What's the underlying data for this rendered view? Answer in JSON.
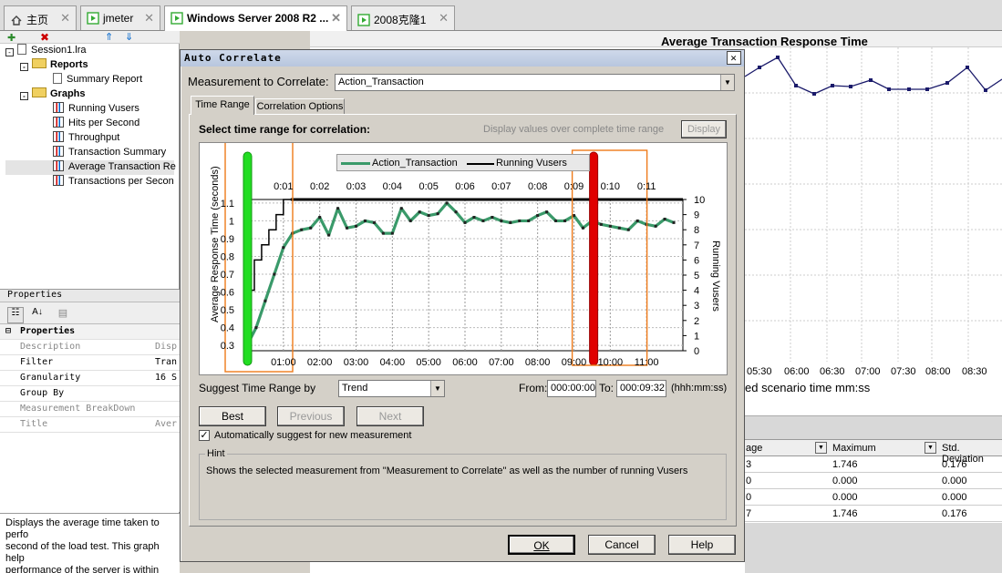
{
  "tabs": [
    {
      "label": "主页",
      "active": false
    },
    {
      "label": "jmeter",
      "active": false
    },
    {
      "label": "Windows Server 2008 R2 ...",
      "active": true
    },
    {
      "label": "2008克隆1",
      "active": false
    }
  ],
  "tree": {
    "session": "Session1.lra",
    "reports": "Reports",
    "summary_report": "Summary Report",
    "graphs": "Graphs",
    "items": [
      "Running Vusers",
      "Hits per Second",
      "Throughput",
      "Transaction Summary",
      "Average Transaction Re",
      "Transactions per Secon"
    ]
  },
  "properties": {
    "panel_title": "Properties",
    "section": "Properties",
    "rows": [
      {
        "key": "Description",
        "value": "Disp",
        "gray": true
      },
      {
        "key": "Filter",
        "value": "Tran",
        "gray": false
      },
      {
        "key": "Granularity",
        "value": "16 S",
        "gray": false
      },
      {
        "key": "Group By",
        "value": "",
        "gray": false
      },
      {
        "key": "Measurement BreakDown",
        "value": "",
        "gray": true
      },
      {
        "key": "Title",
        "value": "Aver",
        "gray": true
      }
    ]
  },
  "description_lines": [
    "Displays the average time taken to perfo",
    "second of the load test. This graph help",
    "performance of the server is within acce"
  ],
  "background_graph": {
    "title": "Average Transaction Response Time",
    "x_ticks": [
      "05:30",
      "06:00",
      "06:30",
      "07:00",
      "07:30",
      "08:00",
      "08:30"
    ],
    "x_label": "ed scenario time mm:ss"
  },
  "grid": {
    "headers": [
      "age",
      "Maximum",
      "Std. Deviation"
    ],
    "rows": [
      [
        "3",
        "1.746",
        "0.176"
      ],
      [
        "0",
        "0.000",
        "0.000"
      ],
      [
        "0",
        "0.000",
        "0.000"
      ],
      [
        "7",
        "1.746",
        "0.176"
      ]
    ]
  },
  "dialog": {
    "title": "Auto Correlate",
    "measurement_label": "Measurement to Correlate:",
    "measurement_value": "Action_Transaction",
    "tab_time_range": "Time Range",
    "tab_options": "Correlation Options",
    "select_label": "Select time range for correlation:",
    "display_hint": "Display values over complete time range",
    "display_button": "Display",
    "suggest_label": "Suggest Time Range by",
    "suggest_value": "Trend",
    "from_label": "From:",
    "from_value": "000:00:00",
    "to_label": "To:",
    "to_value": "000:09:32",
    "time_format": "(hhh:mm:ss)",
    "best": "Best",
    "previous": "Previous",
    "next": "Next",
    "auto_suggest": "Automatically suggest for new measurement",
    "hint_title": "Hint",
    "hint_text": "Shows the selected measurement from \"Measurement to Correlate\" as well as the number of running Vusers",
    "ok": "OK",
    "cancel": "Cancel",
    "help": "Help"
  },
  "chart_data": {
    "type": "line",
    "legend": [
      "Action_Transaction",
      "Running Vusers"
    ],
    "ylabel": "Average Response Time (seconds)",
    "y2label": "Running Vusers",
    "top_ticks": [
      "0:01",
      "0:02",
      "0:03",
      "0:04",
      "0:05",
      "0:06",
      "0:07",
      "0:08",
      "0:09",
      "0:10",
      "0:11"
    ],
    "bottom_ticks": [
      "01:00",
      "02:00",
      "03:00",
      "04:00",
      "05:00",
      "06:00",
      "07:00",
      "08:00",
      "09:00",
      "10:00",
      "11:00"
    ],
    "y_ticks": [
      "0.3",
      "0.4",
      "0.5",
      "0.6",
      "0.7",
      "0.8",
      "0.9",
      "1",
      "1.1"
    ],
    "y2_ticks": [
      "0",
      "1",
      "2",
      "3",
      "4",
      "5",
      "6",
      "7",
      "8",
      "9",
      "10"
    ],
    "ylim": [
      0.27,
      1.12
    ],
    "y2lim": [
      0,
      10
    ],
    "xlim": [
      0,
      12
    ],
    "series": [
      {
        "name": "Action_Transaction",
        "color": "#3a9a6a",
        "x": [
          0,
          0.25,
          0.5,
          0.75,
          1,
          1.25,
          1.5,
          1.75,
          2,
          2.25,
          2.5,
          2.75,
          3,
          3.25,
          3.5,
          3.75,
          4,
          4.25,
          4.5,
          4.75,
          5,
          5.25,
          5.5,
          5.75,
          6,
          6.25,
          6.5,
          6.75,
          7,
          7.25,
          7.5,
          7.75,
          8,
          8.25,
          8.5,
          8.75,
          9,
          9.25,
          9.5,
          9.75,
          10,
          10.25,
          10.5,
          10.75,
          11,
          11.25,
          11.5,
          11.75
        ],
        "values": [
          0.3,
          0.4,
          0.55,
          0.7,
          0.85,
          0.93,
          0.95,
          0.96,
          1.02,
          0.92,
          1.07,
          0.96,
          0.97,
          1.0,
          0.99,
          0.93,
          0.93,
          1.07,
          1.0,
          1.05,
          1.03,
          1.04,
          1.1,
          1.05,
          0.99,
          1.02,
          1.0,
          1.02,
          1.0,
          0.99,
          1.0,
          1.0,
          1.03,
          1.05,
          1.0,
          1.0,
          1.03,
          0.96,
          1.0,
          0.98,
          0.97,
          0.96,
          0.95,
          1.0,
          0.98,
          0.97,
          1.01,
          0.99
        ]
      },
      {
        "name": "Running Vusers",
        "color": "#000000",
        "x": [
          0,
          0.2,
          0.4,
          0.6,
          0.8,
          1,
          1.2,
          11.9
        ],
        "values": [
          4,
          6,
          7,
          8,
          9,
          10,
          10,
          10
        ]
      }
    ],
    "selection": {
      "start": "000:00:00",
      "end": "000:09:32"
    }
  }
}
